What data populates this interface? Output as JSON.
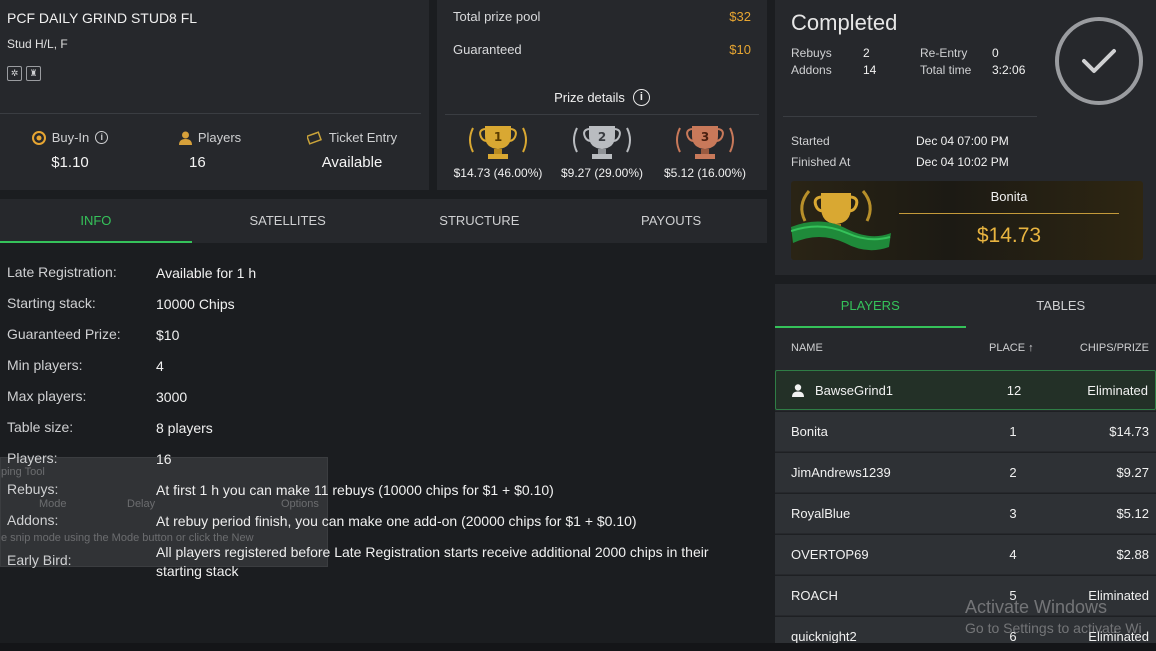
{
  "header": {
    "title": "PCF DAILY GRIND STUD8 FL",
    "subtitle": "Stud H/L, F",
    "stats": [
      {
        "label": "Buy-In",
        "value": "$1.10",
        "icon": "chip-icon"
      },
      {
        "label": "Players",
        "value": "16",
        "icon": "user-icon"
      },
      {
        "label": "Ticket Entry",
        "value": "Available",
        "icon": "ticket-icon"
      }
    ]
  },
  "prize": {
    "total_label": "Total prize pool",
    "total_value": "$32",
    "guaranteed_label": "Guaranteed",
    "guaranteed_value": "$10",
    "details_label": "Prize details",
    "places": [
      {
        "rank": "1",
        "value": "$14.73 (46.00%)",
        "color": "#d9a832"
      },
      {
        "rank": "2",
        "value": "$9.27 (29.00%)",
        "color": "#b9bcc0"
      },
      {
        "rank": "3",
        "value": "$5.12 (16.00%)",
        "color": "#c8795a"
      }
    ]
  },
  "status": {
    "title": "Completed",
    "rebuys_label": "Rebuys",
    "rebuys_value": "2",
    "addons_label": "Addons",
    "addons_value": "14",
    "reentry_label": "Re-Entry",
    "reentry_value": "0",
    "totaltime_label": "Total time",
    "totaltime_value": "3:2:06",
    "started_label": "Started",
    "started_value": "Dec 04 07:00 PM",
    "finished_label": "Finished At",
    "finished_value": "Dec 04 10:02 PM",
    "winner_name": "Bonita",
    "winner_amount": "$14.73"
  },
  "tabs": [
    "INFO",
    "SATELLITES",
    "STRUCTURE",
    "PAYOUTS"
  ],
  "info": [
    {
      "k": "Late Registration:",
      "v": "Available for 1 h"
    },
    {
      "k": "Starting stack:",
      "v": "10000 Chips"
    },
    {
      "k": "Guaranteed Prize:",
      "v": "$10"
    },
    {
      "k": "Min players:",
      "v": "4"
    },
    {
      "k": "Max players:",
      "v": "3000"
    },
    {
      "k": "Table size:",
      "v": "8 players"
    },
    {
      "k": "Players:",
      "v": "16"
    },
    {
      "k": "Rebuys:",
      "v": "At first 1 h you can make 11 rebuys (10000 chips for $1 + $0.10)"
    },
    {
      "k": "Addons:",
      "v": "At rebuy period finish, you can make one add-on (20000 chips for $1 + $0.10)"
    },
    {
      "k": "Early Bird:",
      "v": "All players registered before Late Registration starts receive additional 2000 chips in their starting stack"
    }
  ],
  "snip": {
    "title": "ping Tool",
    "mode": "Mode",
    "delay": "Delay",
    "options": "Options",
    "hint": "e snip mode using the Mode button or click the New"
  },
  "players": {
    "tabs": [
      "PLAYERS",
      "TABLES"
    ],
    "col_name": "NAME",
    "col_place": "PLACE ↑",
    "col_chips": "CHIPS/PRIZE",
    "rows": [
      {
        "name": "BawseGrind1",
        "place": "12",
        "prize": "Eliminated"
      },
      {
        "name": "Bonita",
        "place": "1",
        "prize": "$14.73"
      },
      {
        "name": "JimAndrews1239",
        "place": "2",
        "prize": "$9.27"
      },
      {
        "name": "RoyalBlue",
        "place": "3",
        "prize": "$5.12"
      },
      {
        "name": "OVERTOP69",
        "place": "4",
        "prize": "$2.88"
      },
      {
        "name": "ROACH",
        "place": "5",
        "prize": "Eliminated"
      },
      {
        "name": "quicknight2",
        "place": "6",
        "prize": "Eliminated"
      }
    ]
  },
  "watermark": {
    "line1": "Activate Windows",
    "line2": "Go to Settings to activate Wi"
  }
}
